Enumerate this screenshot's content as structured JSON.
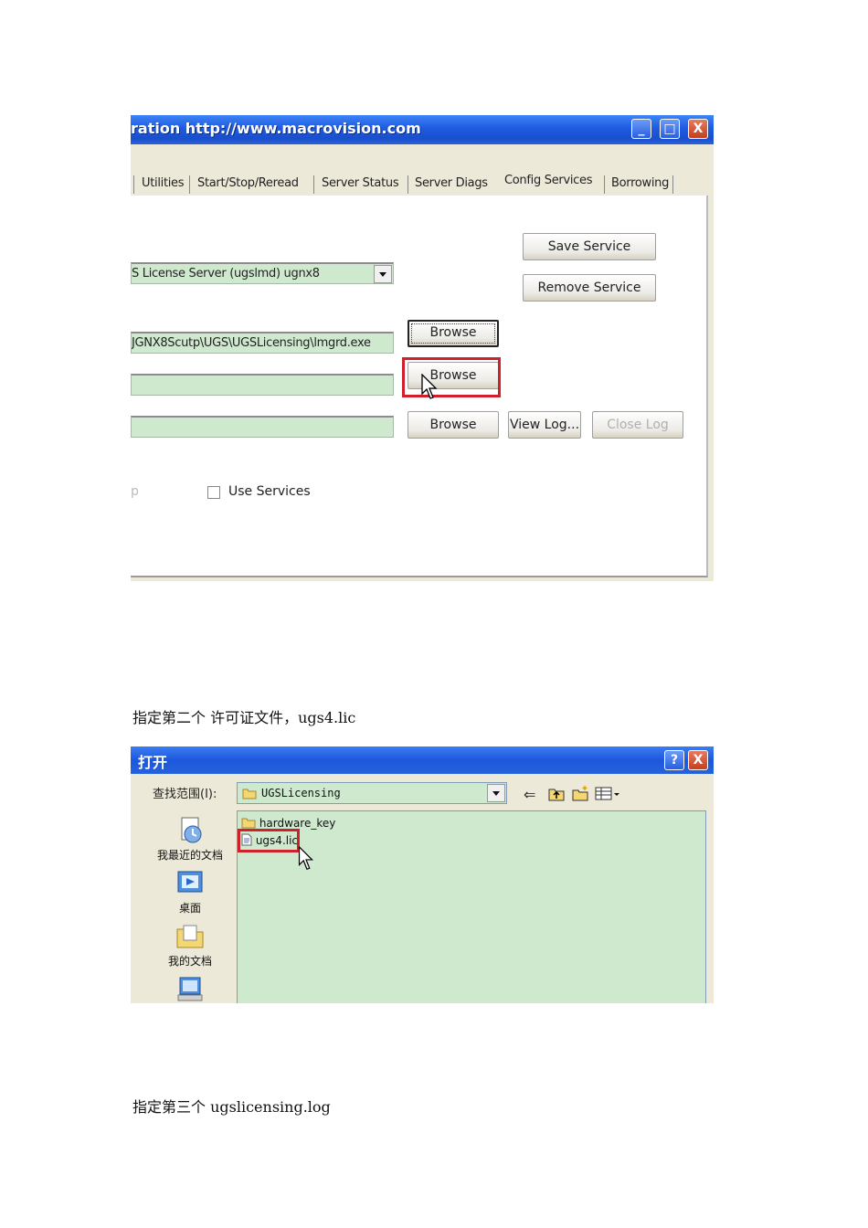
{
  "shot1": {
    "title": "ration http://www.macrovision.com",
    "window_buttons": {
      "minimize": "_",
      "maximize": "□",
      "close": "X"
    },
    "tabs": [
      {
        "label": "Utilities"
      },
      {
        "label": "Start/Stop/Reread"
      },
      {
        "label": "Server Status"
      },
      {
        "label": "Server Diags"
      },
      {
        "label": "Config Services",
        "active": true
      },
      {
        "label": "Borrowing"
      }
    ],
    "save_service_label": "Save Service",
    "remove_service_label": "Remove Service",
    "service_name_value": "S License Server (ugslmd) ugnx8",
    "lmgrd_path_value": "JGNX8Scutp\\UGS\\UGSLicensing\\lmgrd.exe",
    "license_file_value": "",
    "debug_log_value": "",
    "browse_label": "Browse",
    "view_log_label": "View Log...",
    "close_log_label": "Close Log",
    "partial_left_text": "p",
    "use_services_label": "Use Services",
    "highlight_color": "#d0202a"
  },
  "caption1": "指定第二个 许可证文件，ugs4.lic",
  "shot2": {
    "title": "打开",
    "help_button": "?",
    "close_button": "X",
    "lookin_label": "查找范围(I):",
    "lookin_value": "UGSLicensing",
    "places": [
      {
        "label": "我最近的文档",
        "icon": "recent-documents-icon"
      },
      {
        "label": "桌面",
        "icon": "desktop-icon"
      },
      {
        "label": "我的文档",
        "icon": "my-documents-icon"
      },
      {
        "label": "",
        "icon": "my-computer-icon"
      }
    ],
    "files": [
      {
        "name": "hardware_key",
        "type": "folder"
      },
      {
        "name": "ugs4.lic",
        "type": "file",
        "highlighted": true
      }
    ]
  },
  "caption2": "指定第三个 ugslicensing.log"
}
